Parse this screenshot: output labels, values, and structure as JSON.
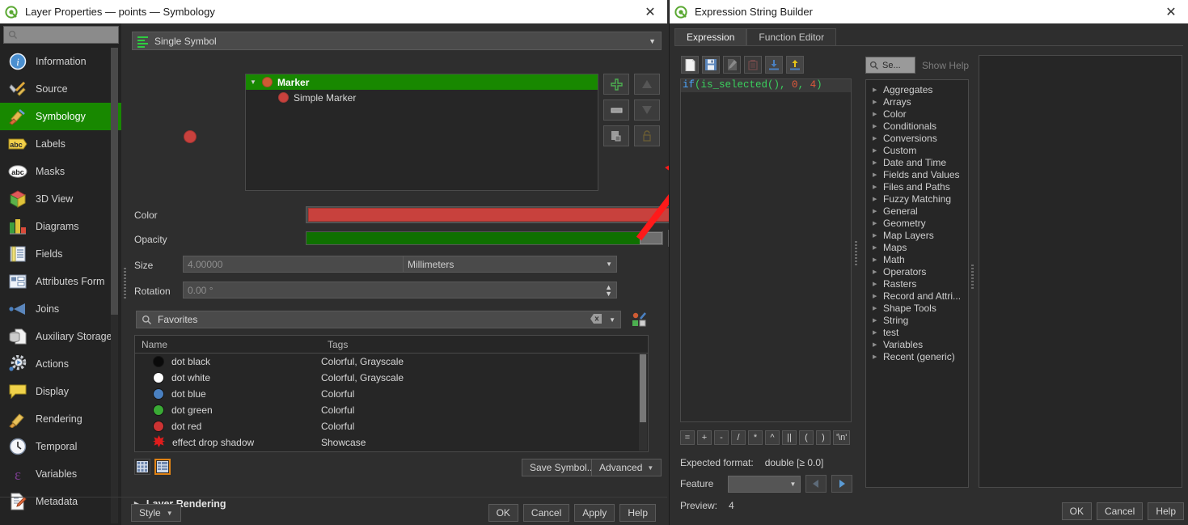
{
  "left_window": {
    "title": "Layer Properties — points — Symbology",
    "close_label": "✕",
    "search_placeholder": "",
    "sidebar": {
      "items": [
        {
          "label": "Information",
          "icon": "info-icon",
          "selected": false
        },
        {
          "label": "Source",
          "icon": "source-icon",
          "selected": false
        },
        {
          "label": "Symbology",
          "icon": "symbology-brush-icon",
          "selected": true
        },
        {
          "label": "Labels",
          "icon": "labels-abc-icon",
          "selected": false
        },
        {
          "label": "Masks",
          "icon": "masks-abc-icon",
          "selected": false
        },
        {
          "label": "3D View",
          "icon": "cube-3d-icon",
          "selected": false
        },
        {
          "label": "Diagrams",
          "icon": "diagrams-icon",
          "selected": false
        },
        {
          "label": "Fields",
          "icon": "fields-icon",
          "selected": false
        },
        {
          "label": "Attributes Form",
          "icon": "attributes-form-icon",
          "selected": false
        },
        {
          "label": "Joins",
          "icon": "joins-icon",
          "selected": false
        },
        {
          "label": "Auxiliary Storage",
          "icon": "auxiliary-storage-icon",
          "selected": false
        },
        {
          "label": "Actions",
          "icon": "actions-gear-icon",
          "selected": false
        },
        {
          "label": "Display",
          "icon": "display-balloon-icon",
          "selected": false
        },
        {
          "label": "Rendering",
          "icon": "rendering-brush-icon",
          "selected": false
        },
        {
          "label": "Temporal",
          "icon": "temporal-clock-icon",
          "selected": false
        },
        {
          "label": "Variables",
          "icon": "variables-epsilon-icon",
          "selected": false
        },
        {
          "label": "Metadata",
          "icon": "metadata-icon",
          "selected": false
        }
      ]
    },
    "renderer": {
      "value": "Single Symbol"
    },
    "layer_tree": {
      "rows": [
        {
          "label": "Marker",
          "selected": true,
          "child": false
        },
        {
          "label": "Simple Marker",
          "selected": false,
          "child": true
        }
      ]
    },
    "layer_tree_buttons": [
      {
        "name": "add-symbol-layer-button",
        "glyph": "plus-icon",
        "enabled": true
      },
      {
        "name": "move-up-button",
        "glyph": "arrow-up-icon",
        "enabled": false
      },
      {
        "name": "remove-symbol-layer-button",
        "glyph": "minus-icon",
        "enabled": true
      },
      {
        "name": "move-down-button",
        "glyph": "arrow-down-icon",
        "enabled": false
      },
      {
        "name": "duplicate-layer-button",
        "glyph": "copy-icon",
        "enabled": true
      },
      {
        "name": "lock-layer-button",
        "glyph": "lock-icon",
        "enabled": false
      }
    ],
    "properties": {
      "color_label": "Color",
      "color_value": "#c8413d",
      "opacity_label": "Opacity",
      "opacity_value": "100.0 %",
      "opacity_percent": 100,
      "size_label": "Size",
      "size_value": "4.00000",
      "size_unit": "Millimeters",
      "rotation_label": "Rotation",
      "rotation_value": "0.00 °"
    },
    "style_browser": {
      "filter_value": "Favorites",
      "columns": [
        "Name",
        "Tags"
      ],
      "rows": [
        {
          "name": "dot  black",
          "tags": "Colorful, Grayscale",
          "swatch": "#0a0a0a"
        },
        {
          "name": "dot  white",
          "tags": "Colorful, Grayscale",
          "swatch": "#ffffff"
        },
        {
          "name": "dot blue",
          "tags": "Colorful",
          "swatch": "#4a80c0"
        },
        {
          "name": "dot green",
          "tags": "Colorful",
          "swatch": "#3aaa35"
        },
        {
          "name": "dot red",
          "tags": "Colorful",
          "swatch": "#cc3333"
        },
        {
          "name": "effect drop shadow",
          "tags": "Showcase",
          "swatch": "#e01c1c"
        }
      ]
    },
    "view_toggle": {
      "grid_label": "grid-view",
      "list_label": "list-view",
      "selected": "list-view"
    },
    "save_symbol_label": "Save Symbol...",
    "advanced_label": "Advanced",
    "layer_rendering_label": "Layer Rendering",
    "style_button_label": "Style",
    "footer_buttons": [
      "OK",
      "Cancel",
      "Apply",
      "Help"
    ]
  },
  "right_window": {
    "title": "Expression String Builder",
    "close_label": "✕",
    "tabs": [
      {
        "label": "Expression",
        "selected": true
      },
      {
        "label": "Function Editor",
        "selected": false
      }
    ],
    "toolbar_buttons": [
      {
        "name": "new-file-button",
        "icon": "new-file-icon",
        "enabled": true
      },
      {
        "name": "save-expression-button",
        "icon": "save-disk-icon",
        "enabled": true
      },
      {
        "name": "edit-expression-button",
        "icon": "edit-pencil-icon",
        "enabled": false
      },
      {
        "name": "delete-expression-button",
        "icon": "trash-icon",
        "enabled": false
      },
      {
        "name": "import-expressions-button",
        "icon": "import-down-icon",
        "enabled": true
      },
      {
        "name": "export-expressions-button",
        "icon": "export-up-icon",
        "enabled": true
      }
    ],
    "expression": {
      "tokens": [
        {
          "text": "if",
          "kind": "keyword"
        },
        {
          "text": "(is_selected(),",
          "kind": "func"
        },
        {
          "text": " 0",
          "kind": "number"
        },
        {
          "text": ",",
          "kind": "func"
        },
        {
          "text": " 4",
          "kind": "number"
        },
        {
          "text": ")",
          "kind": "func"
        }
      ],
      "plain": "if(is_selected(), 0, 4)"
    },
    "operators": [
      "=",
      "+",
      "-",
      "/",
      "*",
      "^",
      "||",
      "(",
      ")",
      "'\\n'"
    ],
    "expected_format_label": "Expected format:",
    "expected_format_value": "double [≥ 0.0]",
    "feature_label": "Feature",
    "feature_value": "",
    "preview_label": "Preview:",
    "preview_value": "4",
    "function_search_value": "Se...",
    "show_help_label": "Show Help",
    "function_categories": [
      "Aggregates",
      "Arrays",
      "Color",
      "Conditionals",
      "Conversions",
      "Custom",
      "Date and Time",
      "Fields and Values",
      "Files and Paths",
      "Fuzzy Matching",
      "General",
      "Geometry",
      "Map Layers",
      "Maps",
      "Math",
      "Operators",
      "Rasters",
      "Record and Attri...",
      "Shape Tools",
      "String",
      "test",
      "Variables",
      "Recent (generic)"
    ],
    "footer_buttons": [
      "OK",
      "Cancel",
      "Help"
    ]
  },
  "annotation": {
    "arrow_color": "#ff1a1a",
    "highlight_target": "size-data-defined-override-button"
  }
}
